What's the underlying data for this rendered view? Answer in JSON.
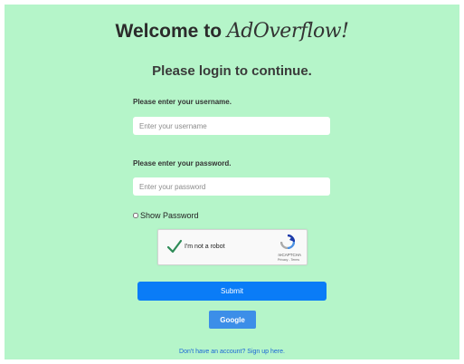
{
  "heading": {
    "prefix": "Welcome to",
    "brand": "AdOverflow!"
  },
  "subtitle": "Please login to continue.",
  "username": {
    "label": "Please enter your username.",
    "placeholder": "Enter your username",
    "value": ""
  },
  "password": {
    "label": "Please enter your password.",
    "placeholder": "Enter your password",
    "value": ""
  },
  "show_password": {
    "label": "Show Password",
    "checked": false
  },
  "captcha": {
    "text": "I'm not a robot",
    "brand": "reCAPTCHA",
    "terms": "Privacy - Terms",
    "checked": true
  },
  "buttons": {
    "submit": "Submit",
    "google": "Google"
  },
  "signup_link": "Don't have an account? Sign up here.",
  "colors": {
    "background": "#b5f5c9",
    "submit": "#0a7cf7",
    "google": "#3c8ee8",
    "link": "#1a66d6",
    "check": "#2e8b57"
  }
}
